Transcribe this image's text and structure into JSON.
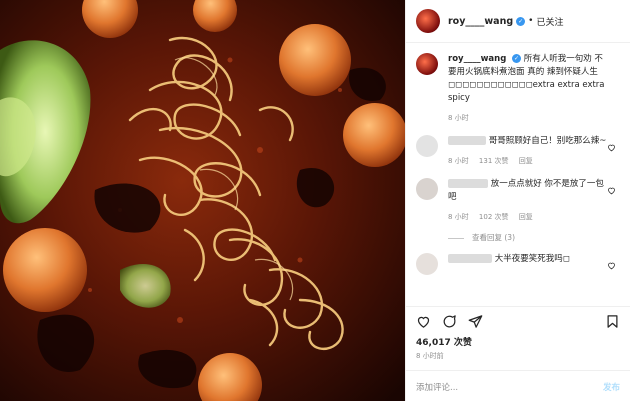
{
  "header": {
    "username": "roy____wang",
    "follow_state": "已关注"
  },
  "caption": {
    "username": "roy____wang",
    "text": "所有人听我一句劝 不要用火锅底料煮泡面 真的 辣到怀疑人生◻◻◻◻◻◻◻◻◻◻◻◻extra extra extra spicy",
    "time": "8 小时"
  },
  "comments": [
    {
      "text": "哥哥照顾好自己！别吃那么辣~",
      "time": "8 小时",
      "likes": "131 次赞",
      "reply": "回复"
    },
    {
      "text": "放一点点就好 你不是放了一包吧",
      "time": "8 小时",
      "likes": "102 次赞",
      "reply": "回复"
    },
    {
      "text": "大半夜要笑死我吗◻",
      "time": "",
      "likes": "",
      "reply": ""
    }
  ],
  "view_replies": "查看回复 (3)",
  "likes_count": "46,017 次赞",
  "post_time": "8 小时前",
  "add_comment": {
    "placeholder": "添加评论...",
    "post_label": "发布"
  },
  "colors": {
    "verified": "#3897f0",
    "muted": "#8e8e8e",
    "post_disabled": "#b2dffc"
  }
}
